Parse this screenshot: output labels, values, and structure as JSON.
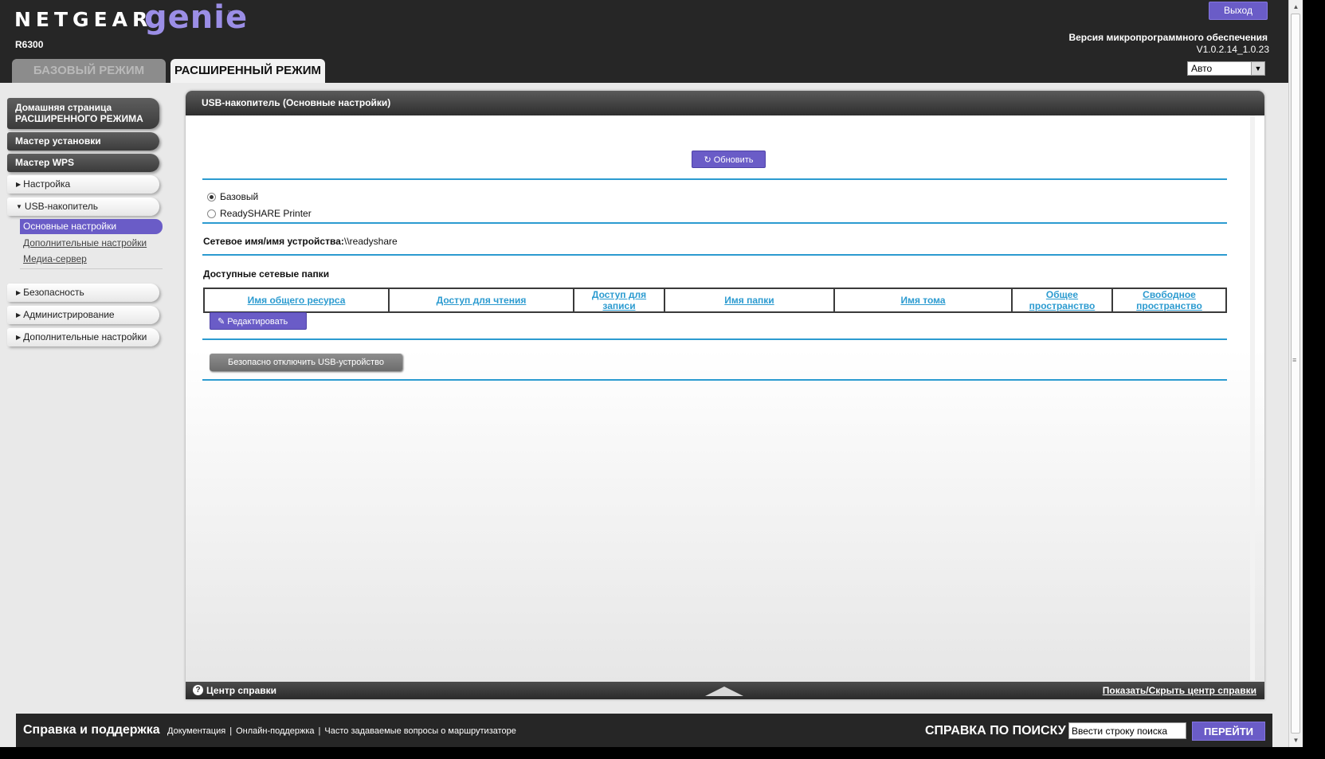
{
  "header": {
    "brand": "NETGEAR",
    "brand_genie": "genie",
    "brand_tm": "™",
    "model": "R6300",
    "logout_label": "Выход",
    "firmware_label": "Версия микропрограммного обеспечения",
    "firmware_version": "V1.0.2.14_1.0.23",
    "language_value": "Авто"
  },
  "tabs": [
    {
      "label": "БАЗОВЫЙ РЕЖИМ",
      "active": false
    },
    {
      "label": "РАСШИРЕННЫЙ РЕЖИМ",
      "active": true
    }
  ],
  "sidebar": {
    "home_line1": "Домашняя страница",
    "home_line2": "РАСШИРЕННОГО РЕЖИМА",
    "setup_wizard": "Мастер установки",
    "wps_wizard": "Мастер WPS",
    "setup": "Настройка",
    "usb_storage": "USB-накопитель",
    "usb_sub": [
      "Основные настройки",
      "Дополнительные настройки",
      "Медиа-сервер"
    ],
    "security": "Безопасность",
    "administration": "Администрирование",
    "advanced_setup": "Дополнительные настройки"
  },
  "panel": {
    "title": "USB-накопитель (Основные настройки)",
    "refresh_label": "Обновить",
    "mode_options": [
      {
        "label": "Базовый",
        "checked": true
      },
      {
        "label": "ReadySHARE Printer",
        "checked": false
      }
    ],
    "network_name_label": "Сетевое имя/имя устройства:",
    "network_name_value": "\\\\readyshare",
    "folders_label": "Доступные сетевые папки",
    "columns": [
      "Имя общего ресурса",
      "Доступ для чтения",
      "Доступ для записи",
      "Имя папки",
      "Имя тома",
      "Общее пространство",
      "Свободное пространство"
    ],
    "edit_label": "Редактировать",
    "eject_label": "Безопасно отключить USB-устройство"
  },
  "help_bar": {
    "label": "Центр справки",
    "toggle": "Показать/Скрыть центр справки"
  },
  "footer": {
    "title": "Справка и поддержка",
    "links": [
      "Документация",
      "Онлайн-поддержка",
      "Часто задаваемые вопросы о маршрутизаторе"
    ],
    "search_label": "СПРАВКА ПО ПОИСКУ",
    "search_placeholder": "Ввести строку поиска",
    "go_label": "ПЕРЕЙТИ"
  },
  "colors": {
    "accent": "#6a5cc7",
    "link": "#2c9bd0",
    "header_bg": "#262626"
  }
}
